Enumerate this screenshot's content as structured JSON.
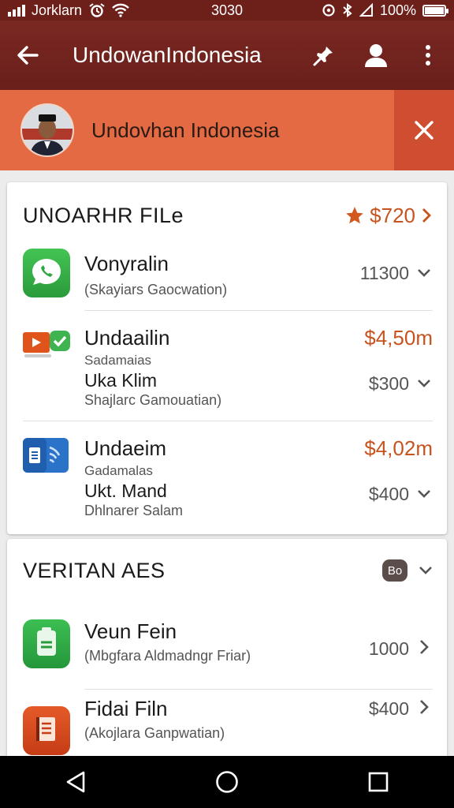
{
  "status_bar": {
    "carrier": "Jorklarn",
    "time": "3030",
    "battery": "100%",
    "battery_level": 1.0
  },
  "app_bar": {
    "title": "UndowanIndonesia"
  },
  "banner": {
    "name": "Undovhan Indonesia"
  },
  "section1": {
    "title": "UNOARHR FILe",
    "total": "$720",
    "items": [
      {
        "name": "Vonyralin",
        "subtitle": "(Skayiars Gaocwation)",
        "value": "11300",
        "icon": "phone-chat-icon",
        "color": "#3bb54a"
      },
      {
        "name": "Undaailin",
        "price": "$4,50m",
        "sub1": "Sadamaias",
        "line2": "Uka Klim",
        "sub2": "Shajlarc Gamouatian)",
        "value": "$300",
        "icon": "video-check-icon",
        "color": "#e0541c"
      },
      {
        "name": "Undaeim",
        "price": "$4,02m",
        "sub1": "Gadamalas",
        "line2": "Ukt. Mand",
        "sub2": "Dhlnarer Salam",
        "value": "$400",
        "icon": "document-wave-icon",
        "color": "#2b73c9"
      }
    ]
  },
  "section2": {
    "title": "VERITAN AES",
    "badge": "Bo",
    "items": [
      {
        "name": "Veun Fein",
        "subtitle": "(Mbgfara Aldmadngr Friar)",
        "value": "1000",
        "icon": "clipboard-icon",
        "color": "#2eaa47"
      },
      {
        "name": "Fidai Filn",
        "subtitle": "(Akojlara Ganpwatian)",
        "value": "$400",
        "icon": "notebook-icon",
        "color": "#d9471c"
      }
    ]
  }
}
